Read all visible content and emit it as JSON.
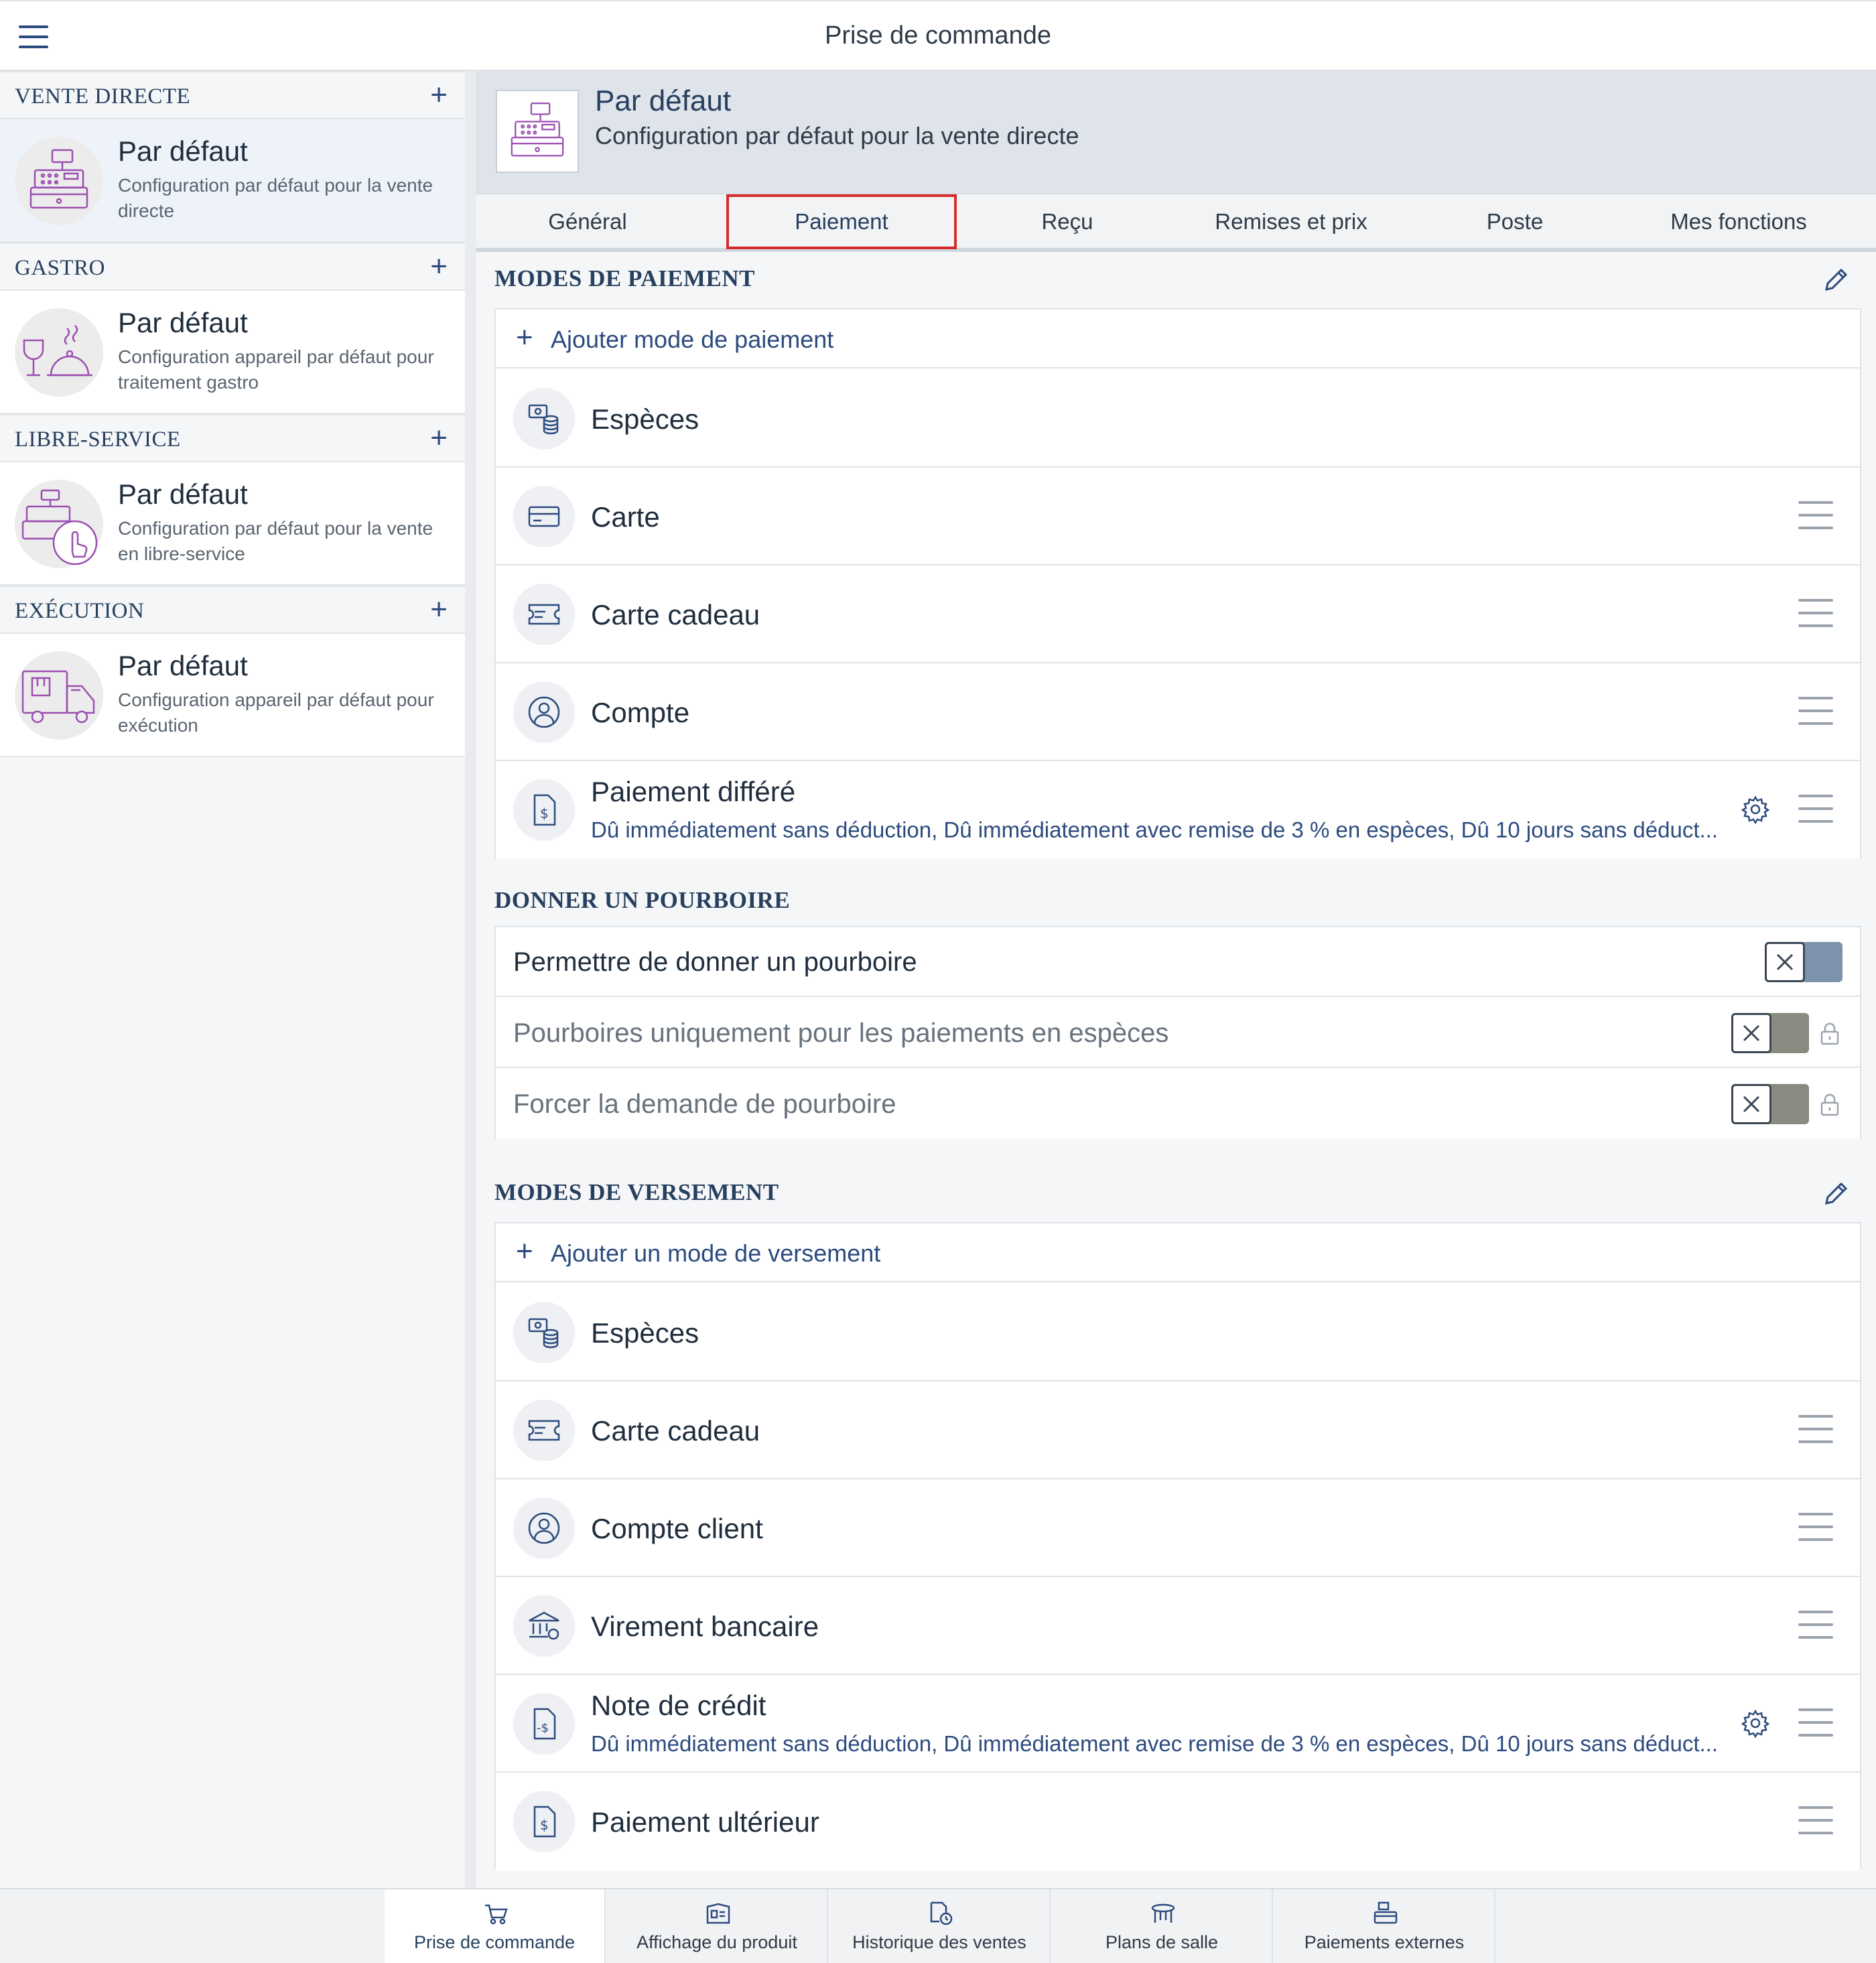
{
  "app": {
    "title": "Prise de commande"
  },
  "sidebar": {
    "sections": [
      {
        "title": "VENTE DIRECTE",
        "item": {
          "title": "Par défaut",
          "subtitle": "Configuration par défaut pour la vente directe"
        }
      },
      {
        "title": "GASTRO",
        "item": {
          "title": "Par défaut",
          "subtitle": "Configuration appareil par défaut pour traitement gastro"
        }
      },
      {
        "title": "LIBRE-SERVICE",
        "item": {
          "title": "Par défaut",
          "subtitle": "Configuration par défaut pour la vente en libre-service"
        }
      },
      {
        "title": "EXÉCUTION",
        "item": {
          "title": "Par défaut",
          "subtitle": "Configuration appareil par défaut pour exécution"
        }
      }
    ]
  },
  "detail": {
    "title": "Par défaut",
    "subtitle": "Configuration par défaut pour la vente directe"
  },
  "tabs": [
    "Général",
    "Paiement",
    "Reçu",
    "Remises et prix",
    "Poste",
    "Mes fonctions"
  ],
  "active_tab": "Paiement",
  "payment_modes": {
    "title": "MODES DE PAIEMENT",
    "add_label": "Ajouter mode de paiement",
    "items": [
      {
        "label": "Espèces",
        "icon": "cash-icon"
      },
      {
        "label": "Carte",
        "icon": "card-icon"
      },
      {
        "label": "Carte cadeau",
        "icon": "gift-card-icon"
      },
      {
        "label": "Compte",
        "icon": "account-icon"
      },
      {
        "label": "Paiement différé",
        "icon": "invoice-icon",
        "description": "Dû immédiatement sans déduction, Dû immédiatement avec remise de 3 % en espèces, Dû 10 jours sans déduct..."
      }
    ]
  },
  "tips": {
    "title": "DONNER UN POURBOIRE",
    "items": [
      {
        "label": "Permettre de donner un pourboire",
        "enabled": false,
        "locked": false
      },
      {
        "label": "Pourboires uniquement pour les paiements en espèces",
        "enabled": false,
        "locked": true
      },
      {
        "label": "Forcer la demande de pourboire",
        "enabled": false,
        "locked": true
      }
    ]
  },
  "payout_modes": {
    "title": "MODES DE VERSEMENT",
    "add_label": "Ajouter un mode de versement",
    "items": [
      {
        "label": "Espèces",
        "icon": "cash-icon"
      },
      {
        "label": "Carte cadeau",
        "icon": "gift-card-icon"
      },
      {
        "label": "Compte client",
        "icon": "account-icon"
      },
      {
        "label": "Virement bancaire",
        "icon": "bank-icon"
      },
      {
        "label": "Note de crédit",
        "icon": "credit-note-icon",
        "description": "Dû immédiatement sans déduction, Dû immédiatement avec remise de 3 % en espèces, Dû 10 jours sans déduct..."
      },
      {
        "label": "Paiement ultérieur",
        "icon": "invoice-icon"
      }
    ]
  },
  "bottom_nav": {
    "items": [
      "Prise de commande",
      "Affichage du produit",
      "Historique des ventes",
      "Plans de salle",
      "Paiements externes"
    ],
    "active": "Prise de commande"
  },
  "colors": {
    "accent": "#2c4b7e",
    "highlight": "#d62b2b",
    "illustration": "#9b4fb0"
  }
}
